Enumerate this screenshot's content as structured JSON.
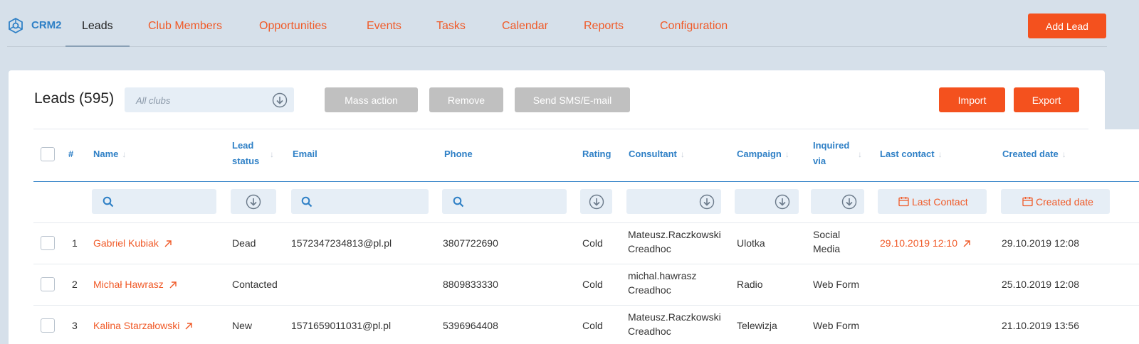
{
  "app": {
    "name": "CRM2"
  },
  "nav": {
    "items": [
      "Leads",
      "Club Members",
      "Opportunities",
      "Events",
      "Tasks",
      "Calendar",
      "Reports",
      "Configuration"
    ],
    "add_lead": "Add Lead"
  },
  "page": {
    "title": "Leads (595)",
    "club_filter_placeholder": "All clubs",
    "mass_action": "Mass action",
    "remove": "Remove",
    "send": "Send SMS/E-mail",
    "import": "Import",
    "export": "Export"
  },
  "table": {
    "headers": {
      "num": "#",
      "name": "Name",
      "lead_status_1": "Lead",
      "lead_status_2": "status",
      "email": "Email",
      "phone": "Phone",
      "rating": "Rating",
      "consultant": "Consultant",
      "campaign": "Campaign",
      "inquired_1": "Inquired",
      "inquired_2": "via",
      "last_contact": "Last contact",
      "created": "Created date"
    },
    "filters": {
      "last_contact": "Last Contact",
      "created": "Created date"
    },
    "rows": [
      {
        "num": "1",
        "name": "Gabriel Kubiak",
        "status": "Dead",
        "email": "1572347234813@pl.pl",
        "phone": "3807722690",
        "rating": "Cold",
        "consultant_1": "Mateusz.Raczkowski",
        "consultant_2": "Creadhoc",
        "campaign": "Ulotka",
        "inquired_1": "Social",
        "inquired_2": "Media",
        "last_contact": "29.10.2019 12:10",
        "created": "29.10.2019 12:08"
      },
      {
        "num": "2",
        "name": "Michał Hawrasz",
        "status": "Contacted",
        "email": "",
        "phone": "8809833330",
        "rating": "Cold",
        "consultant_1": "michal.hawrasz",
        "consultant_2": "Creadhoc",
        "campaign": "Radio",
        "inquired_1": "Web Form",
        "inquired_2": "",
        "last_contact": "",
        "created": "25.10.2019 12:08"
      },
      {
        "num": "3",
        "name": "Kalina Starzałowski",
        "status": "New",
        "email": "1571659011031@pl.pl",
        "phone": "5396964408",
        "rating": "Cold",
        "consultant_1": "Mateusz.Raczkowski",
        "consultant_2": "Creadhoc",
        "campaign": "Telewizja",
        "inquired_1": "Web Form",
        "inquired_2": "",
        "last_contact": "",
        "created": "21.10.2019 13:56"
      }
    ]
  },
  "colors": {
    "accent": "#f4511e",
    "link": "#2f80c6",
    "background": "#d6e0ea"
  }
}
